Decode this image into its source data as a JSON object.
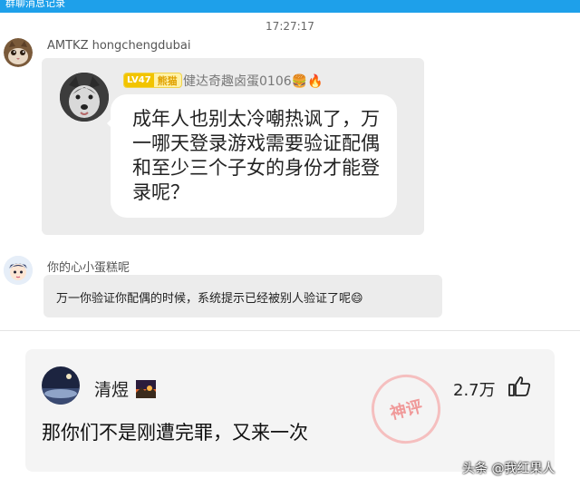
{
  "window": {
    "title": "群聊消息记录"
  },
  "chat": {
    "time": "17:27:17",
    "messages": [
      {
        "sender": "AMTKZ hongchengdubai",
        "embedded": {
          "level": "LV47",
          "level_title": "熊猫",
          "name": "健达奇趣卤蛋0106🍔🔥",
          "text": "成年人也别太冷嘲热讽了，万一哪天登录游戏需要验证配偶和至少三个子女的身份才能登录呢？"
        }
      },
      {
        "sender": "你的心小蛋糕呢",
        "text": "万一你验证你配偶的时候，系统提示已经被别人验证了呢😄"
      }
    ]
  },
  "comment": {
    "user": "清煜",
    "likes": "2.7万",
    "text": "那你们不是刚遭完罪，又来一次",
    "stamp": "神评"
  },
  "watermark": "头条 @我红果人",
  "colors": {
    "titlebar": "#1ea0ea",
    "bubble": "#ececec",
    "card": "#f4f4f4",
    "stamp": "#f08a8a"
  }
}
